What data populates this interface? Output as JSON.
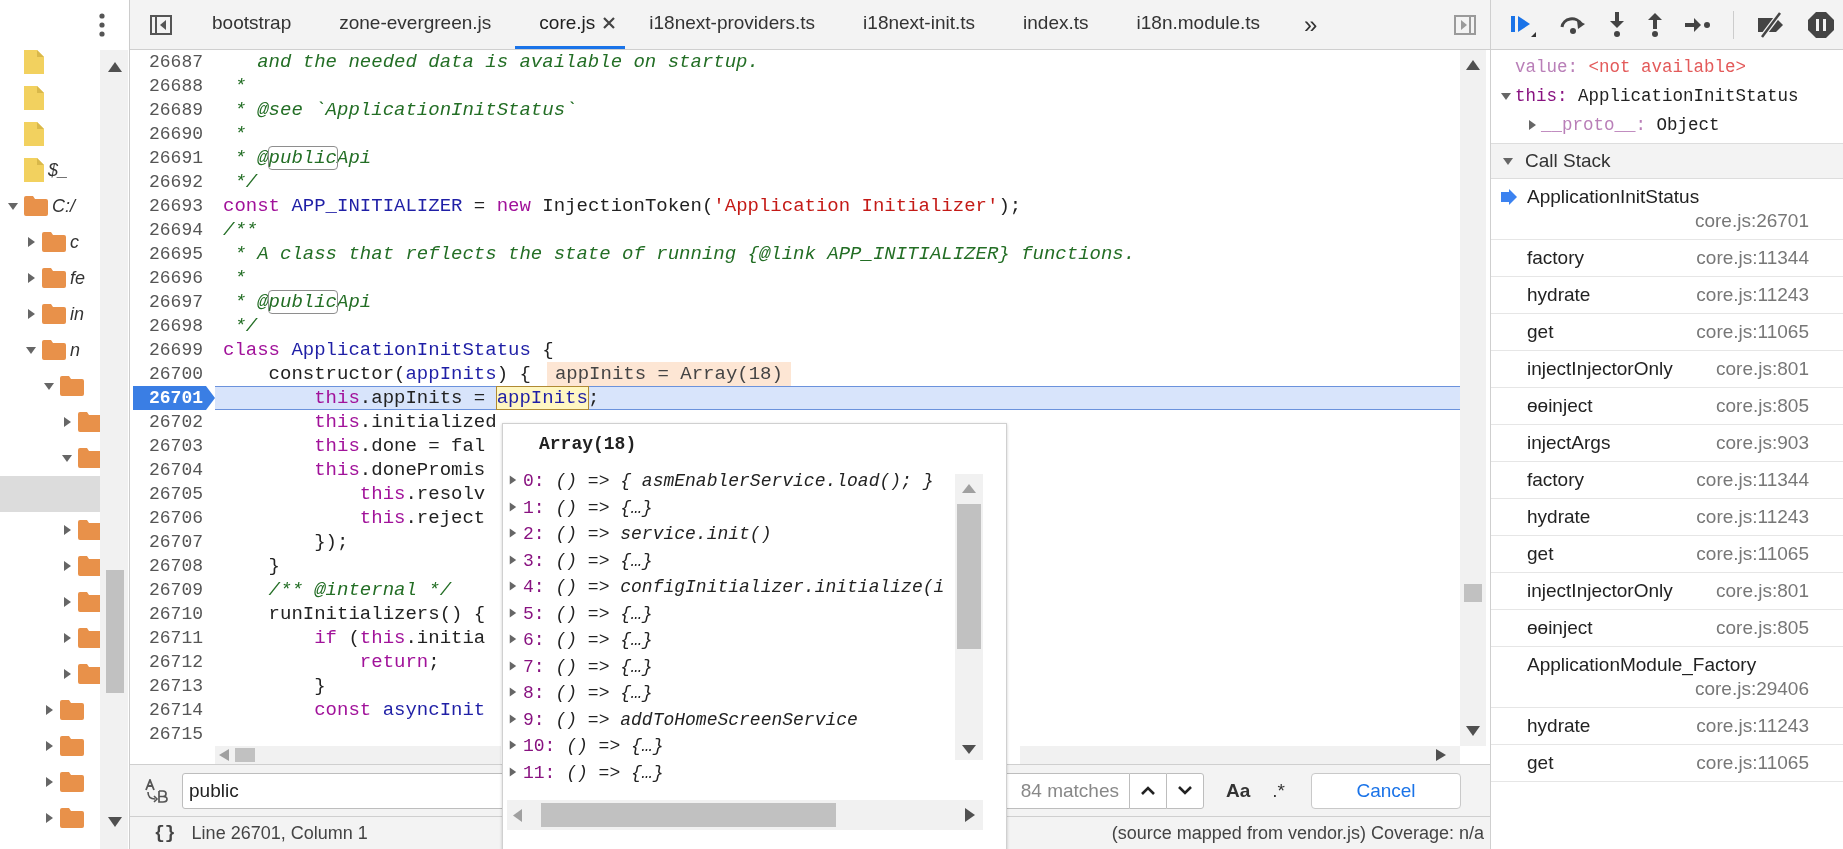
{
  "sidebar": {
    "tree": [
      {
        "kind": "file",
        "selected": false
      },
      {
        "kind": "file",
        "selected": false
      },
      {
        "kind": "file",
        "selected": false
      },
      {
        "kind": "file",
        "label": "$_",
        "selected": false
      },
      {
        "kind": "folder",
        "label": "C:/",
        "expanded": true,
        "selected": false,
        "children": [
          {
            "kind": "folder",
            "label": "c",
            "expanded": false,
            "selected": false
          },
          {
            "kind": "folder",
            "label": "fe",
            "expanded": false,
            "selected": false
          },
          {
            "kind": "folder",
            "label": "in",
            "expanded": false,
            "selected": false
          },
          {
            "kind": "folder",
            "label": "n",
            "expanded": true,
            "selected": false,
            "children": [
              {
                "kind": "folder",
                "expanded": true,
                "selected": false,
                "children": [
                  {
                    "kind": "folder",
                    "expanded": false,
                    "selected": false
                  },
                  {
                    "kind": "folder",
                    "expanded": true,
                    "selected": false,
                    "children": [
                      {
                        "selected": true
                      }
                    ]
                  },
                  {
                    "kind": "folder",
                    "expanded": false,
                    "selected": false
                  },
                  {
                    "kind": "folder",
                    "expanded": false,
                    "selected": false
                  },
                  {
                    "kind": "folder",
                    "expanded": false,
                    "selected": false
                  },
                  {
                    "kind": "folder",
                    "expanded": false,
                    "selected": false
                  },
                  {
                    "kind": "folder",
                    "expanded": false,
                    "selected": false
                  }
                ]
              },
              {
                "kind": "folder",
                "expanded": false,
                "selected": false
              },
              {
                "kind": "folder",
                "expanded": false,
                "selected": false
              },
              {
                "kind": "folder",
                "expanded": false,
                "selected": false
              },
              {
                "kind": "folder",
                "expanded": false,
                "selected": false
              }
            ]
          }
        ]
      }
    ]
  },
  "editor": {
    "tabs": [
      {
        "label": "bootstrap",
        "selected": false
      },
      {
        "label": "zone-evergreen.js",
        "selected": false
      },
      {
        "label": "core.js",
        "selected": true
      },
      {
        "label": "i18next-providers.ts",
        "selected": false
      },
      {
        "label": "i18next-init.ts",
        "selected": false
      },
      {
        "label": "index.ts",
        "selected": false
      },
      {
        "label": "i18n.module.ts",
        "selected": false
      }
    ],
    "more_tabs": "»",
    "lines": [
      {
        "number": "26687",
        "current": false,
        "tokens": [
          {
            "kind": "comment",
            "text": "   and the needed data is available on startup."
          }
        ]
      },
      {
        "number": "26688",
        "current": false,
        "tokens": [
          {
            "kind": "comment",
            "text": " *"
          }
        ]
      },
      {
        "number": "26689",
        "current": false,
        "tokens": [
          {
            "kind": "comment",
            "text": " * @see `ApplicationInitStatus`"
          }
        ]
      },
      {
        "number": "26690",
        "current": false,
        "tokens": [
          {
            "kind": "comment",
            "text": " *"
          }
        ]
      },
      {
        "number": "26691",
        "current": false,
        "tokens": [
          {
            "kind": "comment",
            "text": " * @"
          },
          {
            "kind": "match",
            "text": "public"
          },
          {
            "kind": "comment",
            "text": "Api"
          }
        ]
      },
      {
        "number": "26692",
        "current": false,
        "tokens": [
          {
            "kind": "comment",
            "text": " */"
          }
        ]
      },
      {
        "number": "26693",
        "current": false,
        "tokens": [
          {
            "kind": "keyword",
            "text": "const"
          },
          {
            "kind": "def",
            "text": " APP_INITIALIZER"
          },
          {
            "kind": "plain",
            "text": " = "
          },
          {
            "kind": "keyword",
            "text": "new"
          },
          {
            "kind": "plain",
            "text": " InjectionToken("
          },
          {
            "kind": "string",
            "text": "'Application Initializer'"
          },
          {
            "kind": "plain",
            "text": ");"
          }
        ]
      },
      {
        "number": "26694",
        "current": false,
        "tokens": [
          {
            "kind": "comment",
            "text": "/**"
          }
        ]
      },
      {
        "number": "26695",
        "current": false,
        "tokens": [
          {
            "kind": "comment",
            "text": " * A class that reflects the state of running {@link APP_INITIALIZER} functions."
          }
        ]
      },
      {
        "number": "26696",
        "current": false,
        "tokens": [
          {
            "kind": "comment",
            "text": " *"
          }
        ]
      },
      {
        "number": "26697",
        "current": false,
        "tokens": [
          {
            "kind": "comment",
            "text": " * @"
          },
          {
            "kind": "match",
            "text": "public"
          },
          {
            "kind": "comment",
            "text": "Api"
          }
        ]
      },
      {
        "number": "26698",
        "current": false,
        "tokens": [
          {
            "kind": "comment",
            "text": " */"
          }
        ]
      },
      {
        "number": "26699",
        "current": false,
        "tokens": [
          {
            "kind": "keyword",
            "text": "class"
          },
          {
            "kind": "def",
            "text": " ApplicationInitStatus"
          },
          {
            "kind": "plain",
            "text": " {"
          }
        ]
      },
      {
        "number": "26700",
        "current": false,
        "tokens": [
          {
            "kind": "plain",
            "text": "    constructor("
          },
          {
            "kind": "def",
            "text": "appInits"
          },
          {
            "kind": "plain",
            "text": ") {"
          }
        ],
        "inline_value": "appInits = Array(18)"
      },
      {
        "number": "26701",
        "current": true,
        "tokens": [
          {
            "kind": "keyword",
            "text": "        this"
          },
          {
            "kind": "plain",
            "text": ".appInits = "
          },
          {
            "kind": "hover",
            "text": "appInits"
          },
          {
            "kind": "plain",
            "text": ";"
          }
        ]
      },
      {
        "number": "26702",
        "current": false,
        "tokens": [
          {
            "kind": "keyword",
            "text": "        this"
          },
          {
            "kind": "plain",
            "text": ".initialized"
          }
        ]
      },
      {
        "number": "26703",
        "current": false,
        "tokens": [
          {
            "kind": "keyword",
            "text": "        this"
          },
          {
            "kind": "plain",
            "text": ".done = fal"
          }
        ]
      },
      {
        "number": "26704",
        "current": false,
        "tokens": [
          {
            "kind": "keyword",
            "text": "        this"
          },
          {
            "kind": "plain",
            "text": ".donePromis"
          }
        ]
      },
      {
        "number": "26705",
        "current": false,
        "tokens": [
          {
            "kind": "keyword",
            "text": "            this"
          },
          {
            "kind": "plain",
            "text": ".resolv"
          }
        ]
      },
      {
        "number": "26706",
        "current": false,
        "tokens": [
          {
            "kind": "keyword",
            "text": "            this"
          },
          {
            "kind": "plain",
            "text": ".reject"
          }
        ]
      },
      {
        "number": "26707",
        "current": false,
        "tokens": [
          {
            "kind": "plain",
            "text": "        });"
          }
        ]
      },
      {
        "number": "26708",
        "current": false,
        "tokens": [
          {
            "kind": "plain",
            "text": "    }"
          }
        ]
      },
      {
        "number": "26709",
        "current": false,
        "tokens": [
          {
            "kind": "comment",
            "text": "    /** @internal */"
          }
        ]
      },
      {
        "number": "26710",
        "current": false,
        "tokens": [
          {
            "kind": "plain",
            "text": "    runInitializers() {"
          }
        ]
      },
      {
        "number": "26711",
        "current": false,
        "tokens": [
          {
            "kind": "keyword",
            "text": "        if"
          },
          {
            "kind": "plain",
            "text": " ("
          },
          {
            "kind": "keyword",
            "text": "this"
          },
          {
            "kind": "plain",
            "text": ".initia"
          }
        ]
      },
      {
        "number": "26712",
        "current": false,
        "tokens": [
          {
            "kind": "keyword",
            "text": "            return"
          },
          {
            "kind": "plain",
            "text": ";"
          }
        ]
      },
      {
        "number": "26713",
        "current": false,
        "tokens": [
          {
            "kind": "plain",
            "text": "        }"
          }
        ]
      },
      {
        "number": "26714",
        "current": false,
        "tokens": [
          {
            "kind": "keyword",
            "text": "        const"
          },
          {
            "kind": "def",
            "text": " asyncInit"
          }
        ]
      },
      {
        "number": "26715",
        "current": false
      }
    ]
  },
  "popup": {
    "title": "Array(18)",
    "items": [
      {
        "index": "0:",
        "value": "() => { asmEnablerService.load(); }",
        "expanded": false
      },
      {
        "index": "1:",
        "value": "() => {…}",
        "expanded": false
      },
      {
        "index": "2:",
        "value": "() => service.init()",
        "expanded": false
      },
      {
        "index": "3:",
        "value": "() => {…}",
        "expanded": false
      },
      {
        "index": "4:",
        "value": "() => configInitializer.initialize(i",
        "expanded": false
      },
      {
        "index": "5:",
        "value": "() => {…}",
        "expanded": false
      },
      {
        "index": "6:",
        "value": "() => {…}",
        "expanded": false
      },
      {
        "index": "7:",
        "value": "() => {…}",
        "expanded": false
      },
      {
        "index": "8:",
        "value": "() => {…}",
        "expanded": false
      },
      {
        "index": "9:",
        "value": "() => addToHomeScreenService",
        "expanded": false
      },
      {
        "index": "10:",
        "value": "() => {…}",
        "expanded": false
      },
      {
        "index": "11:",
        "value": "() => {…}",
        "expanded": false
      }
    ]
  },
  "search": {
    "value": "public",
    "matches": "84 matches",
    "case_toggle": "Aa",
    "regex_toggle": ".*",
    "cancel": "Cancel"
  },
  "status_bar": {
    "pretty_print": "{}",
    "position": "Line 26701, Column 1",
    "source": "(source mapped from vendor.js) Coverage: n/a"
  },
  "debugger": {
    "scope": [
      {
        "kind": "unavailable",
        "name": "value:",
        "value": "<not available>"
      },
      {
        "kind": "own",
        "name": "this:",
        "value": "ApplicationInitStatus",
        "expanded": true,
        "children": [
          {
            "kind": "internal",
            "name": "__proto__:",
            "value": "Object",
            "expanded": false
          }
        ]
      }
    ],
    "call_stack": {
      "title": "Call Stack",
      "expanded": true,
      "frames": [
        {
          "name": "ApplicationInitStatus",
          "location": "core.js:26701",
          "selected": true
        },
        {
          "name": "factory",
          "location": "core.js:11344",
          "selected": false
        },
        {
          "name": "hydrate",
          "location": "core.js:11243",
          "selected": false
        },
        {
          "name": "get",
          "location": "core.js:11065",
          "selected": false
        },
        {
          "name": "injectInjectorOnly",
          "location": "core.js:801",
          "selected": false
        },
        {
          "name": "ɵɵinject",
          "location": "core.js:805",
          "selected": false
        },
        {
          "name": "injectArgs",
          "location": "core.js:903",
          "selected": false
        },
        {
          "name": "factory",
          "location": "core.js:11344",
          "selected": false
        },
        {
          "name": "hydrate",
          "location": "core.js:11243",
          "selected": false
        },
        {
          "name": "get",
          "location": "core.js:11065",
          "selected": false
        },
        {
          "name": "injectInjectorOnly",
          "location": "core.js:801",
          "selected": false
        },
        {
          "name": "ɵɵinject",
          "location": "core.js:805",
          "selected": false
        },
        {
          "name": "ApplicationModule_Factory",
          "location": "core.js:29406",
          "selected": false
        },
        {
          "name": "hydrate",
          "location": "core.js:11243",
          "selected": false
        },
        {
          "name": "get",
          "location": "core.js:11065",
          "selected": false
        }
      ]
    }
  }
}
